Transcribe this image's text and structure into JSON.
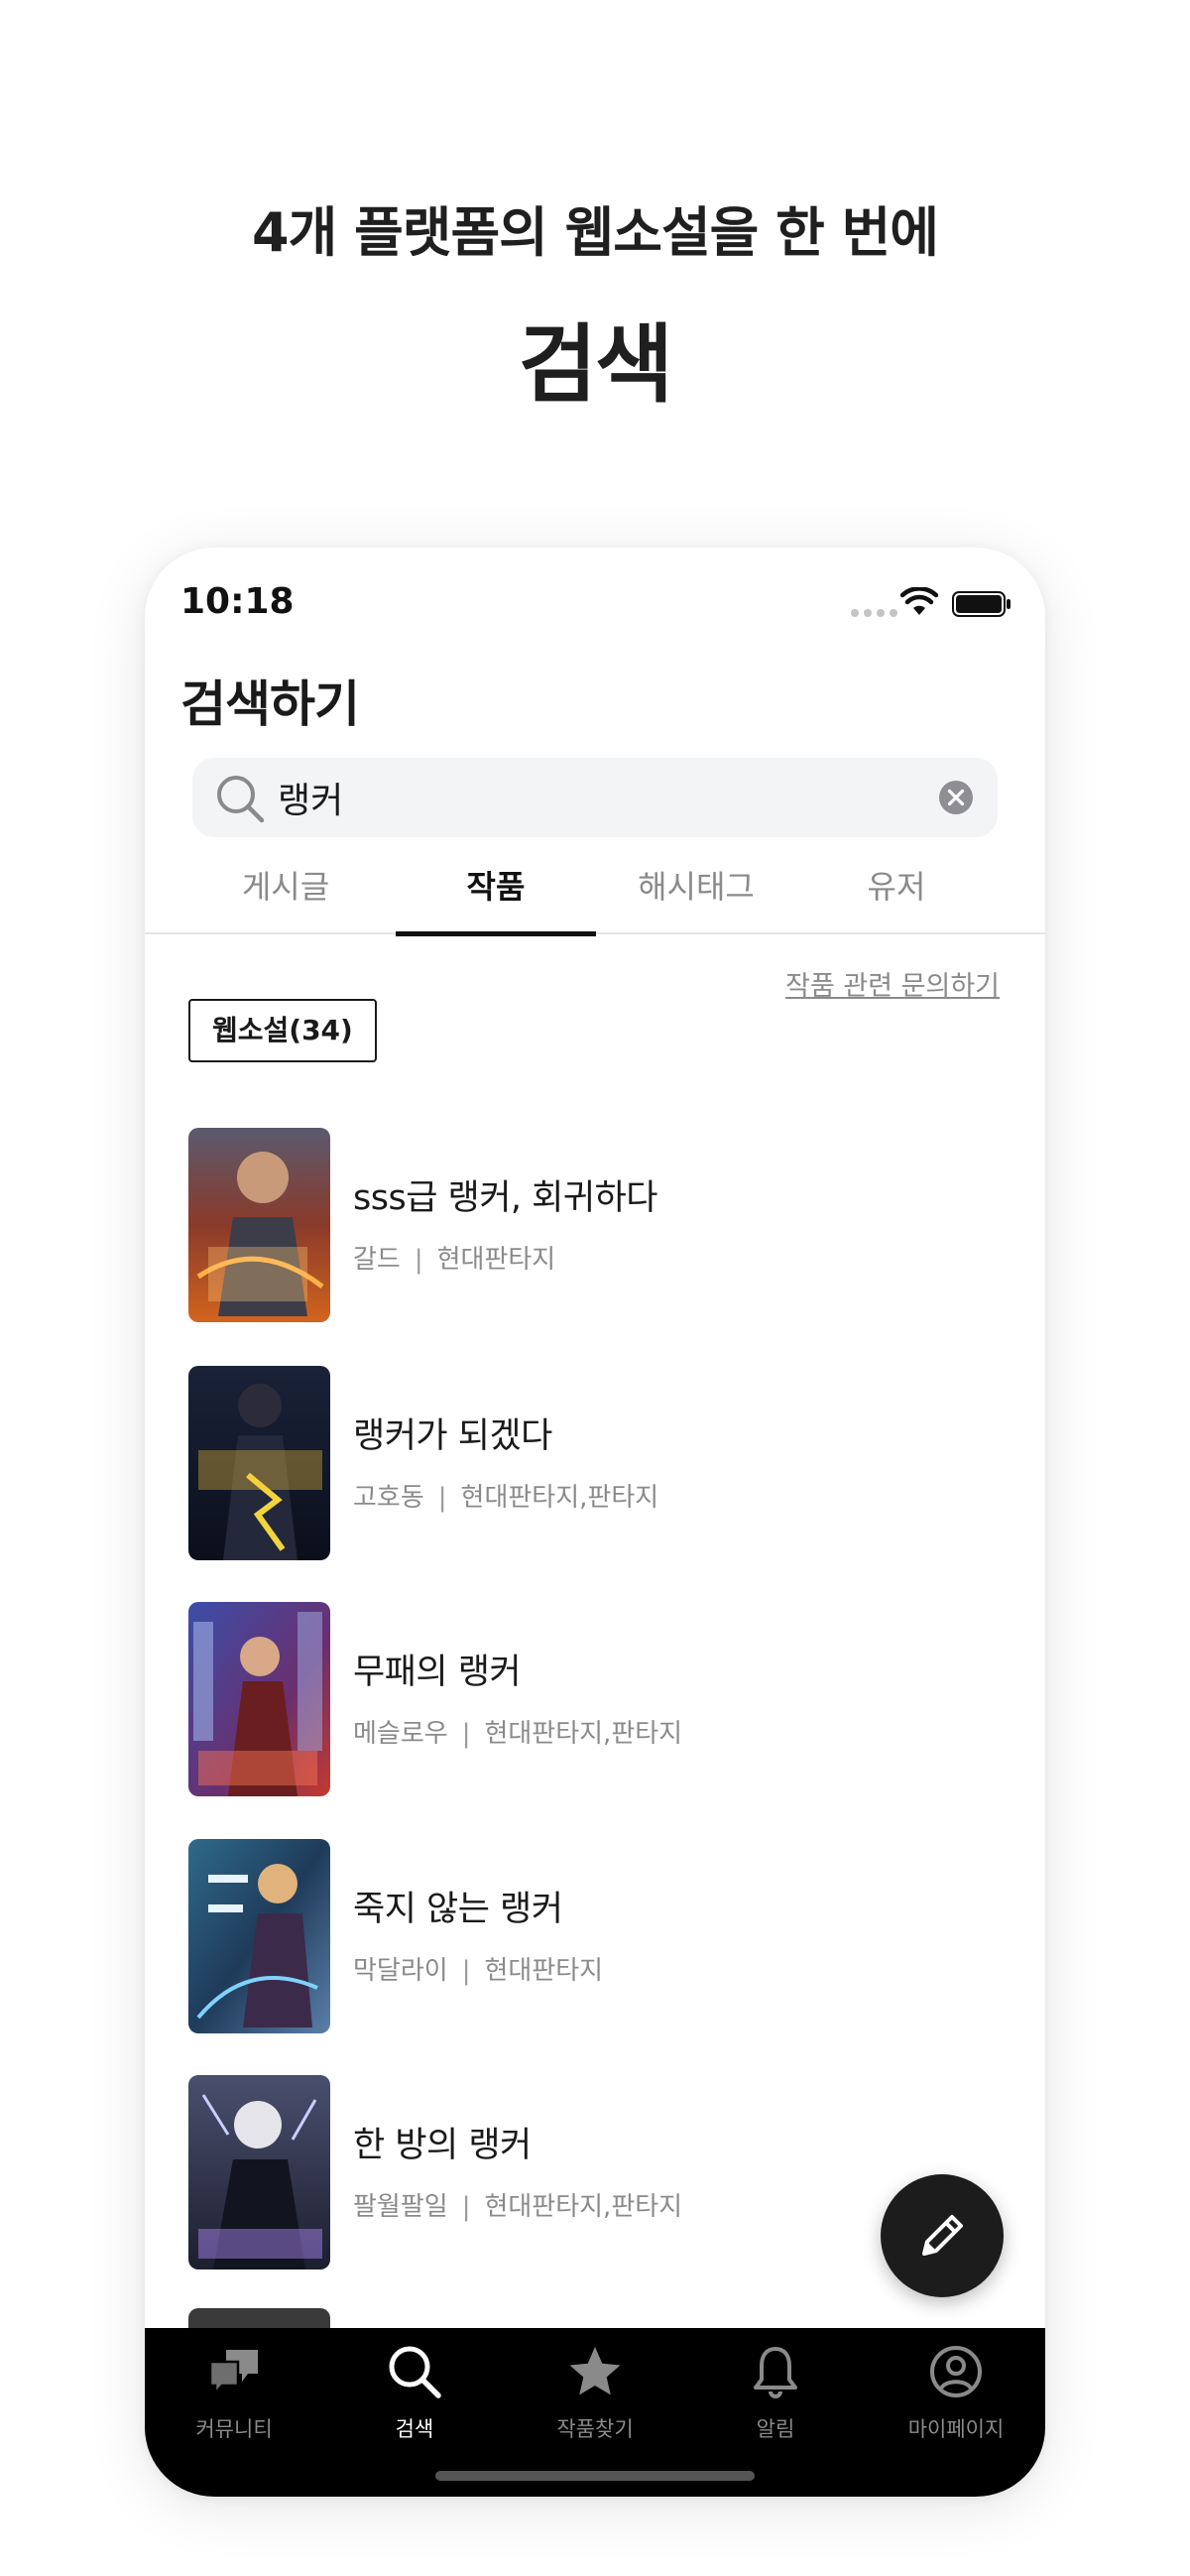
{
  "headline": {
    "sub": "4개 플랫폼의 웹소설을 한 번에",
    "main": "검색"
  },
  "status_bar": {
    "time": "10:18"
  },
  "page_title": "검색하기",
  "search": {
    "value": "랭커",
    "placeholder": ""
  },
  "tabs": [
    {
      "label": "게시글",
      "active": false
    },
    {
      "label": "작품",
      "active": true
    },
    {
      "label": "해시태그",
      "active": false
    },
    {
      "label": "유저",
      "active": false
    }
  ],
  "inquiry_link": "작품 관련 문의하기",
  "category_chip": "웹소설(34)",
  "works": [
    {
      "title": "sss급 랭커, 회귀하다",
      "author": "갈드",
      "genre": "현대판타지"
    },
    {
      "title": "랭커가 되겠다",
      "author": "고호동",
      "genre": "현대판타지,판타지"
    },
    {
      "title": "무패의 랭커",
      "author": "메슬로우",
      "genre": "현대판타지,판타지"
    },
    {
      "title": "죽지 않는 랭커",
      "author": "막달라이",
      "genre": "현대판타지"
    },
    {
      "title": "한 방의 랭커",
      "author": "팔월팔일",
      "genre": "현대판타지,판타지"
    }
  ],
  "meta_separator": "|",
  "bottom_nav": [
    {
      "label": "커뮤니티",
      "icon": "chat-bubbles-icon",
      "active": false
    },
    {
      "label": "검색",
      "icon": "search-icon",
      "active": true
    },
    {
      "label": "작품찾기",
      "icon": "star-icon",
      "active": false
    },
    {
      "label": "알림",
      "icon": "bell-icon",
      "active": false
    },
    {
      "label": "마이페이지",
      "icon": "user-circle-icon",
      "active": false
    }
  ],
  "colors": {
    "accent": "#111111",
    "muted_text": "#8a8a8a",
    "search_bg": "#f3f4f6",
    "nav_bg": "#000000"
  }
}
